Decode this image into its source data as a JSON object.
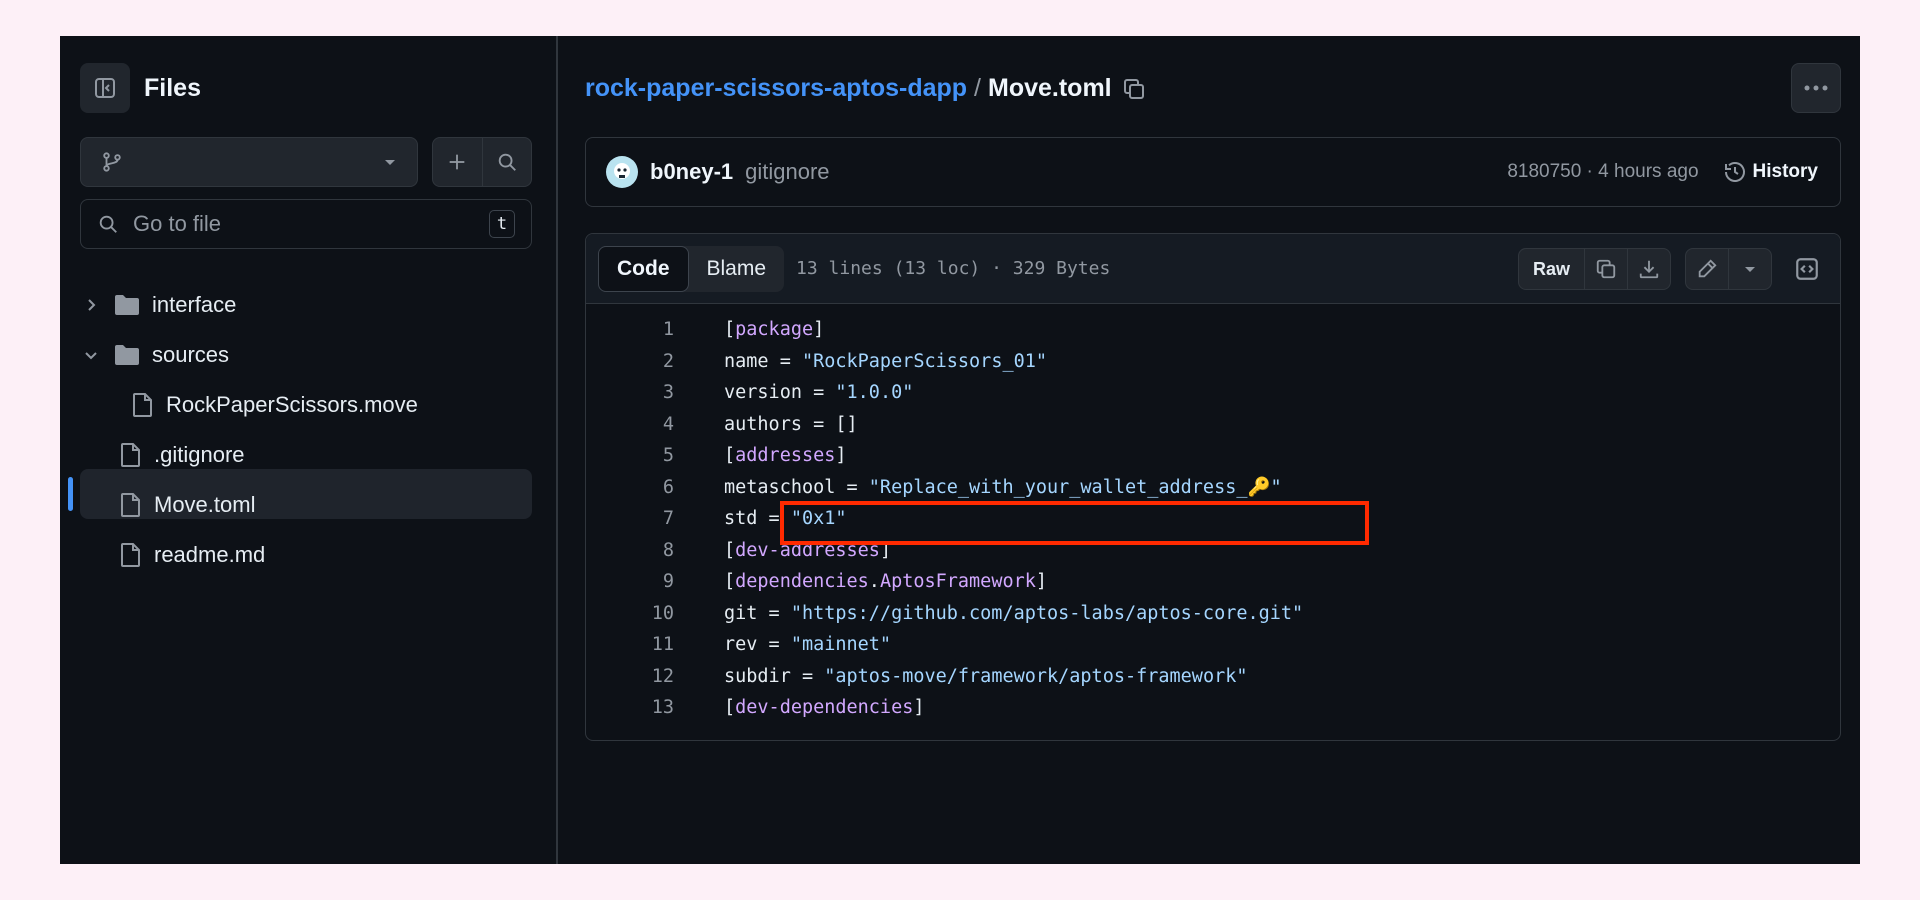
{
  "sidebar": {
    "title": "Files",
    "goto_placeholder": "Go to file",
    "goto_shortcut": "t",
    "tree": [
      {
        "label": "interface",
        "type": "folder",
        "expanded": false
      },
      {
        "label": "sources",
        "type": "folder",
        "expanded": true
      },
      {
        "label": "RockPaperScissors.move",
        "type": "file"
      },
      {
        "label": ".gitignore",
        "type": "file"
      },
      {
        "label": "Move.toml",
        "type": "file",
        "selected": true
      },
      {
        "label": "readme.md",
        "type": "file"
      }
    ]
  },
  "breadcrumb": {
    "repo": "rock-paper-scissors-aptos-dapp",
    "separator": "/",
    "file": "Move.toml"
  },
  "commit": {
    "author": "b0ney-1",
    "message": "gitignore",
    "meta": "8180750 · 4 hours ago",
    "history_label": "History"
  },
  "code": {
    "tabs": [
      "Code",
      "Blame"
    ],
    "active_tab": "Code",
    "info": "13 lines (13 loc) · 329 Bytes",
    "raw_label": "Raw",
    "lines": [
      {
        "n": "1",
        "segs": [
          [
            "p",
            "["
          ],
          [
            "sec",
            "package"
          ],
          [
            "p",
            "]"
          ]
        ]
      },
      {
        "n": "2",
        "segs": [
          [
            "p",
            "name = "
          ],
          [
            "str",
            "\"RockPaperScissors_01\""
          ]
        ]
      },
      {
        "n": "3",
        "segs": [
          [
            "p",
            "version = "
          ],
          [
            "str",
            "\"1.0.0\""
          ]
        ]
      },
      {
        "n": "4",
        "segs": [
          [
            "p",
            "authors = []"
          ]
        ]
      },
      {
        "n": "5",
        "segs": [
          [
            "p",
            "["
          ],
          [
            "sec",
            "addresses"
          ],
          [
            "p",
            "]"
          ]
        ]
      },
      {
        "n": "6",
        "segs": [
          [
            "p",
            "metaschool = "
          ],
          [
            "str",
            "\"Replace_with_your_wallet_address_🔑\""
          ]
        ]
      },
      {
        "n": "7",
        "segs": [
          [
            "p",
            "std = "
          ],
          [
            "str",
            "\"0x1\""
          ]
        ]
      },
      {
        "n": "8",
        "segs": [
          [
            "p",
            "["
          ],
          [
            "sec",
            "dev-addresses"
          ],
          [
            "p",
            "]"
          ]
        ]
      },
      {
        "n": "9",
        "segs": [
          [
            "p",
            "["
          ],
          [
            "sec",
            "dependencies"
          ],
          [
            "p",
            "."
          ],
          [
            "sec",
            "AptosFramework"
          ],
          [
            "p",
            "]"
          ]
        ]
      },
      {
        "n": "10",
        "segs": [
          [
            "p",
            "git = "
          ],
          [
            "str",
            "\"https://github.com/aptos-labs/aptos-core.git\""
          ]
        ]
      },
      {
        "n": "11",
        "segs": [
          [
            "p",
            "rev = "
          ],
          [
            "str",
            "\"mainnet\""
          ]
        ]
      },
      {
        "n": "12",
        "segs": [
          [
            "p",
            "subdir = "
          ],
          [
            "str",
            "\"aptos-move/framework/aptos-framework\""
          ]
        ]
      },
      {
        "n": "13",
        "segs": [
          [
            "p",
            "["
          ],
          [
            "sec",
            "dev-dependencies"
          ],
          [
            "p",
            "]"
          ]
        ]
      }
    ]
  },
  "colors": {
    "accent": "#4493f8",
    "highlight_box": "#ff2a00",
    "toml_section": "#d2a8ff",
    "toml_string": "#a5d6ff"
  }
}
